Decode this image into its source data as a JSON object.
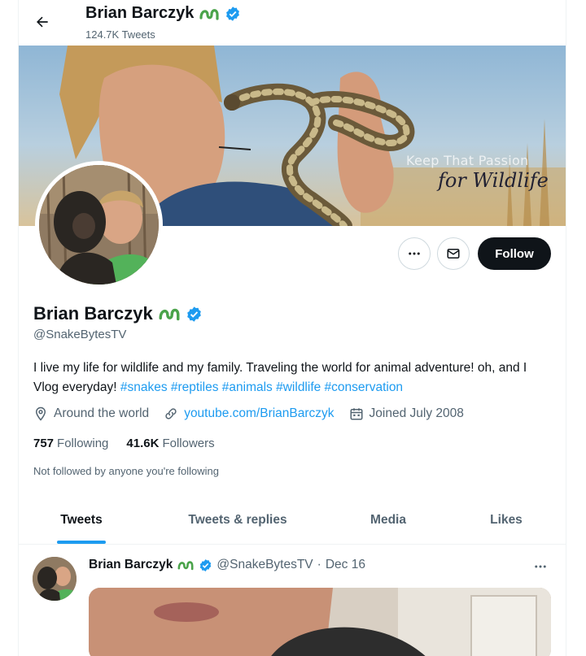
{
  "header": {
    "name": "Brian Barczyk",
    "tweet_count": "124.7K Tweets"
  },
  "banner": {
    "quote": "Keep That Passion",
    "script": "for Wildlife"
  },
  "actions": {
    "more_icon": "more-icon",
    "message_icon": "envelope-icon",
    "follow_label": "Follow"
  },
  "profile": {
    "name": "Brian Barczyk",
    "handle": "@SnakeBytesTV",
    "bio_text": "I live my life for wildlife and my family. Traveling the world for animal adventure! oh, and I Vlog everyday!",
    "bio_tags": "#snakes #reptiles #animals #wildlife #conservation",
    "location": "Around the world",
    "website": "youtube.com/BrianBarczyk",
    "joined": "Joined July 2008",
    "following_count": "757",
    "following_label": "Following",
    "followers_count": "41.6K",
    "followers_label": "Followers",
    "not_followed": "Not followed by anyone you're following"
  },
  "tabs": [
    {
      "label": "Tweets"
    },
    {
      "label": "Tweets & replies"
    },
    {
      "label": "Media"
    },
    {
      "label": "Likes"
    }
  ],
  "tweet": {
    "name": "Brian Barczyk",
    "handle": "@SnakeBytesTV",
    "separator": "·",
    "date": "Dec 16"
  },
  "colors": {
    "accent": "#1d9bf0",
    "follow_button": "#0f1419",
    "secondary_text": "#536471",
    "snake_badge": "#4aa34a"
  }
}
